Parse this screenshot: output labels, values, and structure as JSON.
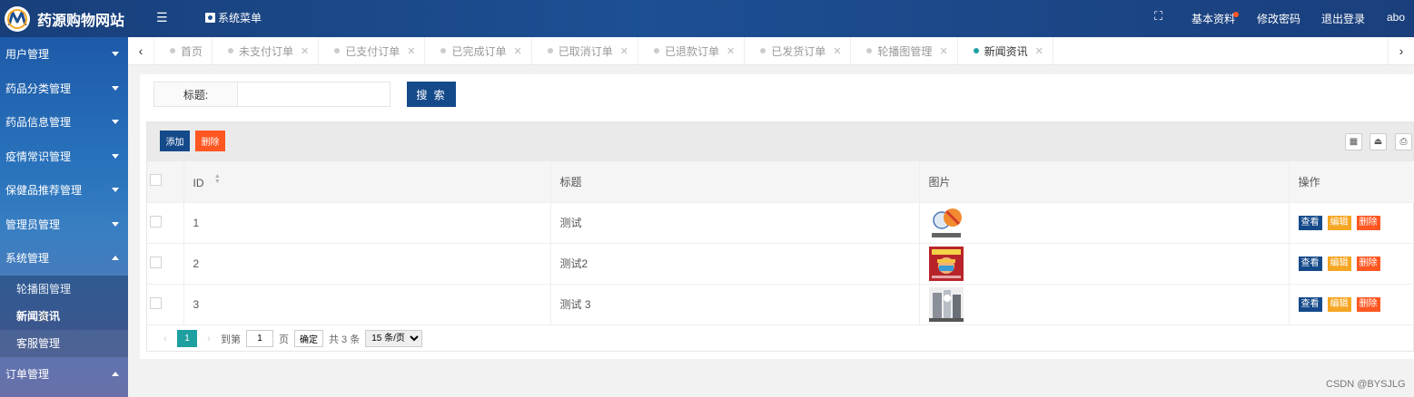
{
  "app": {
    "title": "药源购物网站"
  },
  "header": {
    "menu_label": "系统菜单",
    "basic_info": "基本资料",
    "change_password": "修改密码",
    "logout": "退出登录",
    "username": "abo"
  },
  "sidebar": {
    "items": [
      {
        "label": "用户管理"
      },
      {
        "label": "药品分类管理"
      },
      {
        "label": "药品信息管理"
      },
      {
        "label": "疫情常识管理"
      },
      {
        "label": "保健品推荐管理"
      },
      {
        "label": "管理员管理"
      },
      {
        "label": "系统管理"
      }
    ],
    "sub_items": [
      {
        "label": "轮播图管理"
      },
      {
        "label": "新闻资讯"
      },
      {
        "label": "客服管理"
      }
    ],
    "last_item": "订单管理"
  },
  "tabs": [
    {
      "label": "首页"
    },
    {
      "label": "未支付订单"
    },
    {
      "label": "已支付订单"
    },
    {
      "label": "已完成订单"
    },
    {
      "label": "已取消订单"
    },
    {
      "label": "已退款订单"
    },
    {
      "label": "已发货订单"
    },
    {
      "label": "轮播图管理"
    },
    {
      "label": "新闻资讯"
    }
  ],
  "search": {
    "label": "标题:",
    "value": "",
    "button": "搜 索"
  },
  "toolbar": {
    "add_label": "添加",
    "delete_label": "删除"
  },
  "table": {
    "columns": [
      "ID",
      "标题",
      "图片",
      "操作"
    ],
    "rows": [
      {
        "id": "1",
        "title": "测试"
      },
      {
        "id": "2",
        "title": "测试2"
      },
      {
        "id": "3",
        "title": "测试 3"
      }
    ],
    "actions": {
      "view": "查看",
      "edit": "编辑",
      "delete": "删除"
    }
  },
  "pagination": {
    "current_page": "1",
    "goto_label": "到第",
    "goto_value": "1",
    "page_unit": "页",
    "confirm": "确定",
    "total": "共 3 条",
    "page_size": "15 条/页"
  },
  "colors": {
    "primary": "#154a8a",
    "danger": "#ff5722",
    "warning": "#f5a623",
    "teal": "#1e9fa0"
  },
  "watermark": "CSDN @BYSJLG"
}
